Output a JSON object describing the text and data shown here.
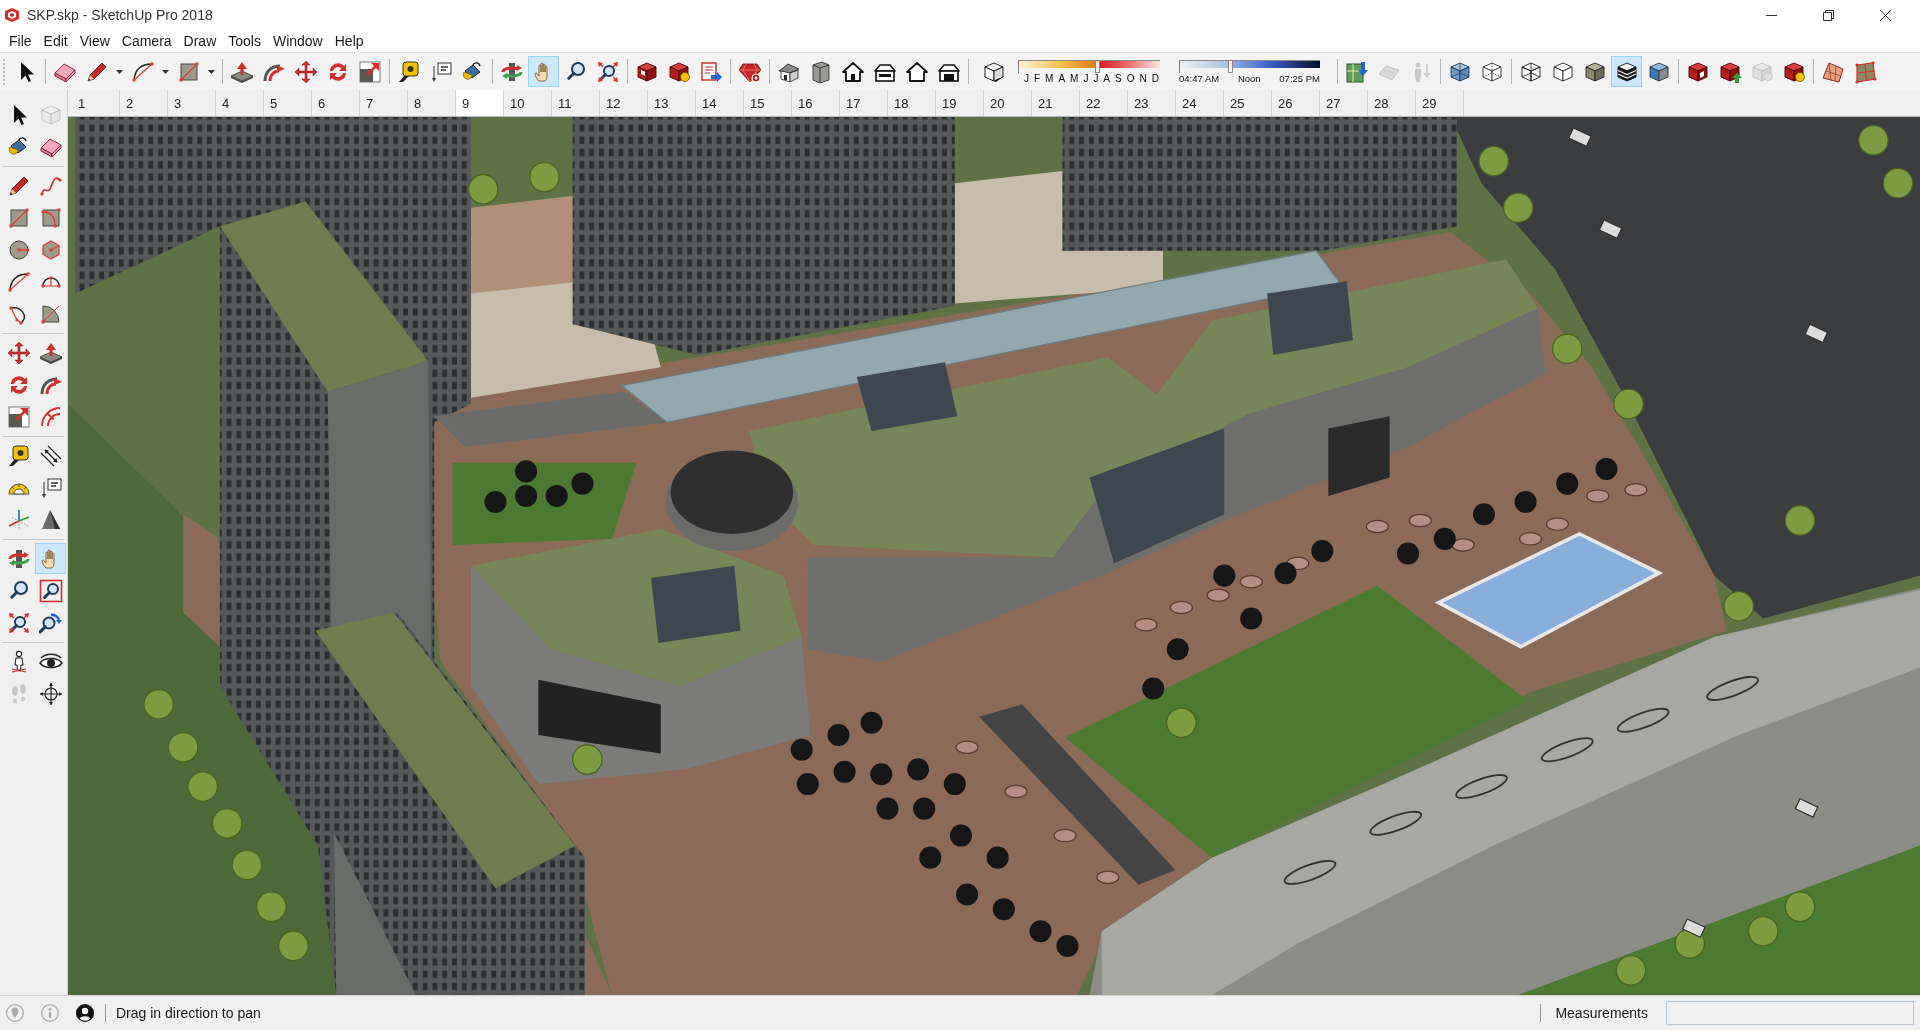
{
  "window": {
    "title": "SKP.skp - SketchUp Pro 2018"
  },
  "menu": [
    "File",
    "Edit",
    "View",
    "Camera",
    "Draw",
    "Tools",
    "Window",
    "Help"
  ],
  "toolbar": [
    {
      "kind": "tools",
      "tools": [
        {
          "selected": false,
          "disabled": false,
          "dropdown": false
        }
      ]
    },
    {
      "kind": "tools",
      "tools": [
        {
          "selected": false,
          "disabled": false,
          "dropdown": false
        },
        {
          "selected": false,
          "disabled": false,
          "dropdown": true
        },
        {
          "selected": false,
          "disabled": false,
          "dropdown": true
        },
        {
          "selected": false,
          "disabled": false,
          "dropdown": true
        }
      ]
    },
    {
      "kind": "tools",
      "tools": [
        {
          "selected": false,
          "disabled": false,
          "dropdown": false
        },
        {
          "selected": false,
          "disabled": false,
          "dropdown": false
        },
        {
          "selected": false,
          "disabled": false,
          "dropdown": false
        },
        {
          "selected": false,
          "disabled": false,
          "dropdown": false
        },
        {
          "selected": false,
          "disabled": false,
          "dropdown": false
        }
      ]
    },
    {
      "kind": "tools",
      "tools": [
        {
          "selected": false,
          "disabled": false,
          "dropdown": false
        },
        {
          "selected": false,
          "disabled": false,
          "dropdown": false
        },
        {
          "selected": false,
          "disabled": false,
          "dropdown": false
        }
      ]
    },
    {
      "kind": "tools",
      "tools": [
        {
          "selected": false,
          "disabled": false,
          "dropdown": false
        },
        {
          "selected": true,
          "disabled": false,
          "dropdown": false
        },
        {
          "selected": false,
          "disabled": false,
          "dropdown": false
        },
        {
          "selected": false,
          "disabled": false,
          "dropdown": false
        }
      ]
    },
    {
      "kind": "tools",
      "tools": [
        {
          "selected": false,
          "disabled": false,
          "dropdown": false
        },
        {
          "selected": false,
          "disabled": false,
          "dropdown": false
        },
        {
          "selected": false,
          "disabled": false,
          "dropdown": false
        }
      ]
    },
    {
      "kind": "tools",
      "tools": [
        {
          "selected": false,
          "disabled": false,
          "dropdown": false
        }
      ]
    },
    {
      "kind": "tools",
      "tools": [
        {
          "selected": false,
          "disabled": false,
          "dropdown": false
        },
        {
          "selected": false,
          "disabled": false,
          "dropdown": false
        },
        {
          "selected": false,
          "disabled": false,
          "dropdown": false
        },
        {
          "selected": false,
          "disabled": false,
          "dropdown": false
        },
        {
          "selected": false,
          "disabled": false,
          "dropdown": false
        },
        {
          "selected": false,
          "disabled": false,
          "dropdown": false
        }
      ]
    },
    {
      "kind": "shadow_settings",
      "tools": [
        {
          "selected": false,
          "disabled": false,
          "dropdown": false
        }
      ],
      "date_slider": {
        "level": 0.56
      },
      "month_labels": [
        "J",
        "F",
        "M",
        "A",
        "M",
        "J",
        "J",
        "A",
        "S",
        "O",
        "N",
        "D"
      ],
      "time_slider": {
        "level": 0.36
      },
      "time_labels": [
        "04:47 AM",
        "Noon",
        "07:25 PM"
      ]
    },
    {
      "kind": "tools",
      "tools": [
        {
          "selected": false,
          "disabled": false,
          "dropdown": false
        },
        {
          "selected": false,
          "disabled": true,
          "dropdown": false
        },
        {
          "selected": false,
          "disabled": true,
          "dropdown": false
        }
      ]
    },
    {
      "kind": "tools",
      "tools": [
        {
          "selected": false,
          "disabled": false,
          "dropdown": false
        },
        {
          "selected": false,
          "disabled": false,
          "dropdown": false
        }
      ]
    },
    {
      "kind": "tools",
      "tools": [
        {
          "selected": false,
          "disabled": false,
          "dropdown": false
        },
        {
          "selected": false,
          "disabled": false,
          "dropdown": false
        },
        {
          "selected": false,
          "disabled": false,
          "dropdown": false
        },
        {
          "selected": true,
          "disabled": false,
          "dropdown": false
        },
        {
          "selected": false,
          "disabled": false,
          "dropdown": false
        }
      ]
    },
    {
      "kind": "tools",
      "tools": [
        {
          "selected": false,
          "disabled": false,
          "dropdown": false
        },
        {
          "selected": false,
          "disabled": false,
          "dropdown": false
        },
        {
          "selected": false,
          "disabled": true,
          "dropdown": false
        },
        {
          "selected": false,
          "disabled": false,
          "dropdown": false
        }
      ]
    },
    {
      "kind": "tools",
      "tools": [
        {
          "selected": false,
          "disabled": false,
          "dropdown": false
        },
        {
          "selected": false,
          "disabled": false,
          "dropdown": false
        }
      ]
    }
  ],
  "side_toolbar": [
    {
      "tools": [
        {
          "selected": false,
          "disabled": false
        },
        {
          "selected": false,
          "disabled": true
        },
        {
          "selected": false,
          "disabled": false
        },
        {
          "selected": false,
          "disabled": false
        }
      ]
    },
    {
      "tools": [
        {
          "selected": false,
          "disabled": false
        },
        {
          "selected": false,
          "disabled": false
        },
        {
          "selected": false,
          "disabled": false
        },
        {
          "selected": false,
          "disabled": false
        },
        {
          "selected": false,
          "disabled": false
        },
        {
          "selected": false,
          "disabled": false
        },
        {
          "selected": false,
          "disabled": false
        },
        {
          "selected": false,
          "disabled": false
        },
        {
          "selected": false,
          "disabled": false
        },
        {
          "selected": false,
          "disabled": false
        }
      ]
    },
    {
      "tools": [
        {
          "selected": false,
          "disabled": false
        },
        {
          "selected": false,
          "disabled": false
        },
        {
          "selected": false,
          "disabled": false
        },
        {
          "selected": false,
          "disabled": false
        },
        {
          "selected": false,
          "disabled": false
        },
        {
          "selected": false,
          "disabled": false
        }
      ]
    },
    {
      "tools": [
        {
          "selected": false,
          "disabled": false
        },
        {
          "selected": false,
          "disabled": false
        },
        {
          "selected": false,
          "disabled": false
        },
        {
          "selected": false,
          "disabled": false
        },
        {
          "selected": false,
          "disabled": false
        },
        {
          "selected": false,
          "disabled": false
        }
      ]
    },
    {
      "tools": [
        {
          "selected": false,
          "disabled": false
        },
        {
          "selected": true,
          "disabled": false
        },
        {
          "selected": false,
          "disabled": false
        },
        {
          "selected": false,
          "disabled": false
        },
        {
          "selected": false,
          "disabled": false
        },
        {
          "selected": false,
          "disabled": false
        }
      ]
    },
    {
      "tools": [
        {
          "selected": false,
          "disabled": false
        },
        {
          "selected": false,
          "disabled": false
        },
        {
          "selected": false,
          "disabled": true
        },
        {
          "selected": false,
          "disabled": false
        }
      ]
    }
  ],
  "scenes": [
    {
      "label": "1",
      "selected": false
    },
    {
      "label": "2",
      "selected": false
    },
    {
      "label": "3",
      "selected": false
    },
    {
      "label": "4",
      "selected": false
    },
    {
      "label": "5",
      "selected": false
    },
    {
      "label": "6",
      "selected": false
    },
    {
      "label": "7",
      "selected": false
    },
    {
      "label": "8",
      "selected": false
    },
    {
      "label": "9",
      "selected": true
    },
    {
      "label": "10",
      "selected": false
    },
    {
      "label": "11",
      "selected": false
    },
    {
      "label": "12",
      "selected": false
    },
    {
      "label": "13",
      "selected": false
    },
    {
      "label": "14",
      "selected": false
    },
    {
      "label": "15",
      "selected": false
    },
    {
      "label": "16",
      "selected": false
    },
    {
      "label": "17",
      "selected": false
    },
    {
      "label": "18",
      "selected": false
    },
    {
      "label": "19",
      "selected": false
    },
    {
      "label": "20",
      "selected": false
    },
    {
      "label": "21",
      "selected": false
    },
    {
      "label": "22",
      "selected": false
    },
    {
      "label": "23",
      "selected": false
    },
    {
      "label": "24",
      "selected": false
    },
    {
      "label": "25",
      "selected": false
    },
    {
      "label": "26",
      "selected": false
    },
    {
      "label": "27",
      "selected": false
    },
    {
      "label": "28",
      "selected": false
    },
    {
      "label": "29",
      "selected": false
    }
  ],
  "status_bar": {
    "message": "Drag in direction to pan",
    "measurements_label": "Measurements"
  }
}
